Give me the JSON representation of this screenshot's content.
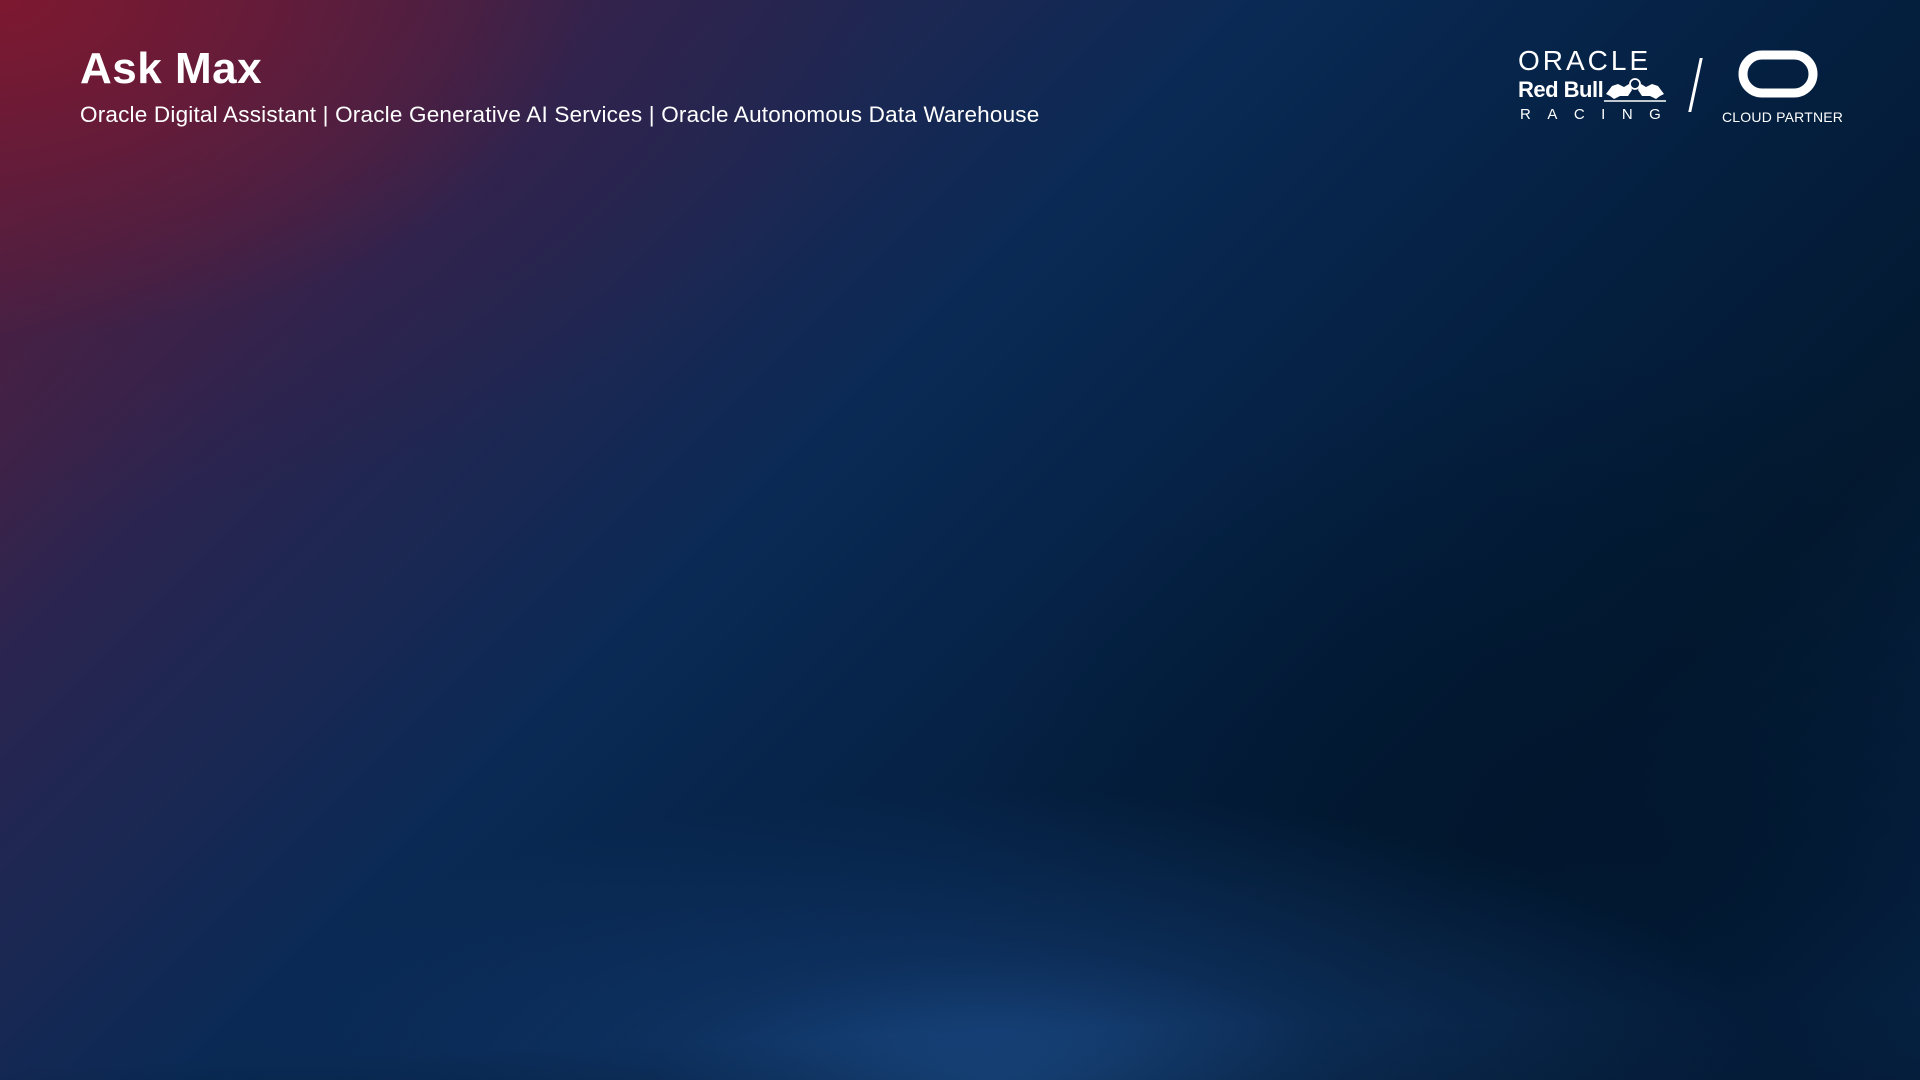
{
  "header": {
    "title": "Ask Max",
    "subtitle": "Oracle Digital Assistant | Oracle Generative AI Services | Oracle Autonomous Data Warehouse"
  },
  "logos": {
    "oracle_wordmark": "ORACLE",
    "redbull_wordmark": "Red Bull",
    "racing_wordmark": "RACING",
    "cloud_partner": "CLOUD PARTNER",
    "icons": [
      "red-bull-bulls-icon",
      "oracle-o-icon"
    ]
  },
  "colors": {
    "text": "#ffffff",
    "background_dark_navy": "#04203f",
    "background_crimson": "#7d1830",
    "background_glow_blue": "#1c4e8c"
  }
}
